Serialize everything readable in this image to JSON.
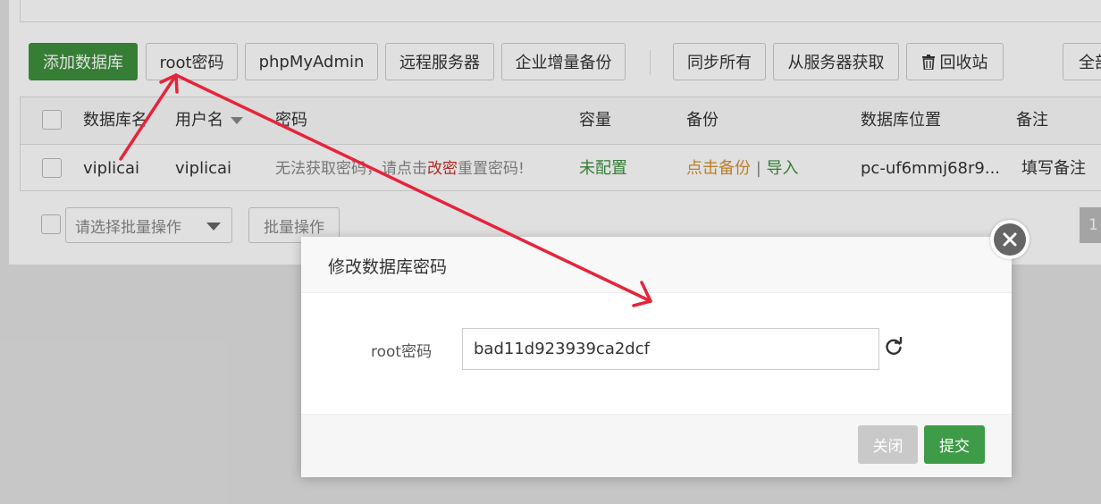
{
  "toolbar": {
    "add_db": "添加数据库",
    "root_pwd": "root密码",
    "phpmyadmin": "phpMyAdmin",
    "remote_server": "远程服务器",
    "incremental_backup": "企业增量备份",
    "sync_all": "同步所有",
    "fetch_from_server": "从服务器获取",
    "recycle_bin": "回收站",
    "all": "全部"
  },
  "table": {
    "headers": {
      "db_name": "数据库名",
      "username": "用户名",
      "password": "密码",
      "capacity": "容量",
      "backup": "备份",
      "location": "数据库位置",
      "note": "备注"
    },
    "row": {
      "db_name": "viplicai",
      "username": "viplicai",
      "pwd_prefix": "无法获取密码，请点击",
      "pwd_link": "改密",
      "pwd_suffix": "重置密码!",
      "capacity": "未配置",
      "backup_link": "点击备份",
      "backup_sep": " | ",
      "import_link": "导入",
      "location": "pc-uf6mmj68r9...",
      "note": "填写备注"
    }
  },
  "batch": {
    "select_placeholder": "请选择批量操作",
    "button": "批量操作",
    "page_number": "1"
  },
  "modal": {
    "title": "修改数据库密码",
    "label": "root密码",
    "value": "bad11d923939ca2dcf",
    "close_label": "关闭",
    "submit_label": "提交"
  },
  "colors": {
    "accent_green": "#3e8f3e",
    "link_red": "#c9302c",
    "link_orange": "#d79232",
    "annotation_red": "#e6243a"
  }
}
